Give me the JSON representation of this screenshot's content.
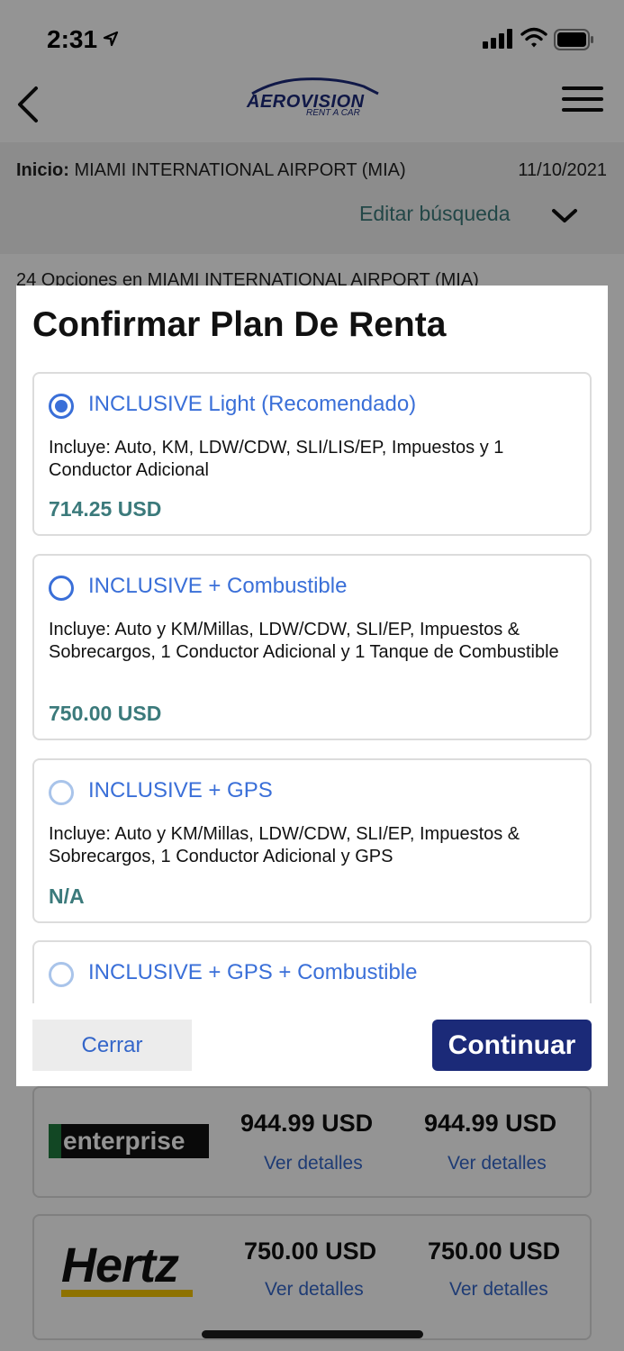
{
  "status_bar": {
    "time": "2:31"
  },
  "header": {
    "logo_text": "AEROVISION",
    "logo_sub": "RENT A CAR"
  },
  "search": {
    "origin_label": "Inicio:",
    "origin_value": "MIAMI INTERNATIONAL AIRPORT (MIA)",
    "date": "11/10/2021",
    "edit_label": "Editar búsqueda"
  },
  "results": {
    "count_text": "24 Opciones en MIAMI INTERNATIONAL AIRPORT (MIA)",
    "vendors": [
      {
        "logo": "enterprise",
        "price_1": "944.99 USD",
        "price_2": "944.99 USD",
        "details_1": "Ver detalles",
        "details_2": "Ver detalles"
      },
      {
        "logo": "Hertz",
        "price_1": "750.00 USD",
        "price_2": "750.00 USD",
        "details_1": "Ver detalles",
        "details_2": "Ver detalles"
      }
    ]
  },
  "modal": {
    "title": "Confirmar Plan De Renta",
    "plans": [
      {
        "name": "INCLUSIVE Light (Recomendado)",
        "description": "Incluye: Auto, KM, LDW/CDW, SLI/LIS/EP, Impuestos y 1 Conductor Adicional",
        "price": "714.25 USD",
        "selected": true
      },
      {
        "name": "INCLUSIVE + Combustible",
        "description": "Incluye: Auto y KM/Millas, LDW/CDW, SLI/EP, Impuestos & Sobrecargos, 1 Conductor Adicional y 1 Tanque de Combustible",
        "price": "750.00 USD",
        "selected": false
      },
      {
        "name": "INCLUSIVE + GPS",
        "description": "Incluye: Auto y KM/Millas, LDW/CDW, SLI/EP, Impuestos & Sobrecargos, 1 Conductor Adicional y GPS",
        "price": "N/A",
        "selected": false
      },
      {
        "name": "INCLUSIVE + GPS + Combustible",
        "description": "",
        "price": "",
        "selected": false
      }
    ],
    "close_label": "Cerrar",
    "continue_label": "Continuar"
  },
  "colors": {
    "accent_blue": "#3a6fd8",
    "brand_navy": "#1b2a78",
    "price_teal": "#3b7a7b"
  }
}
